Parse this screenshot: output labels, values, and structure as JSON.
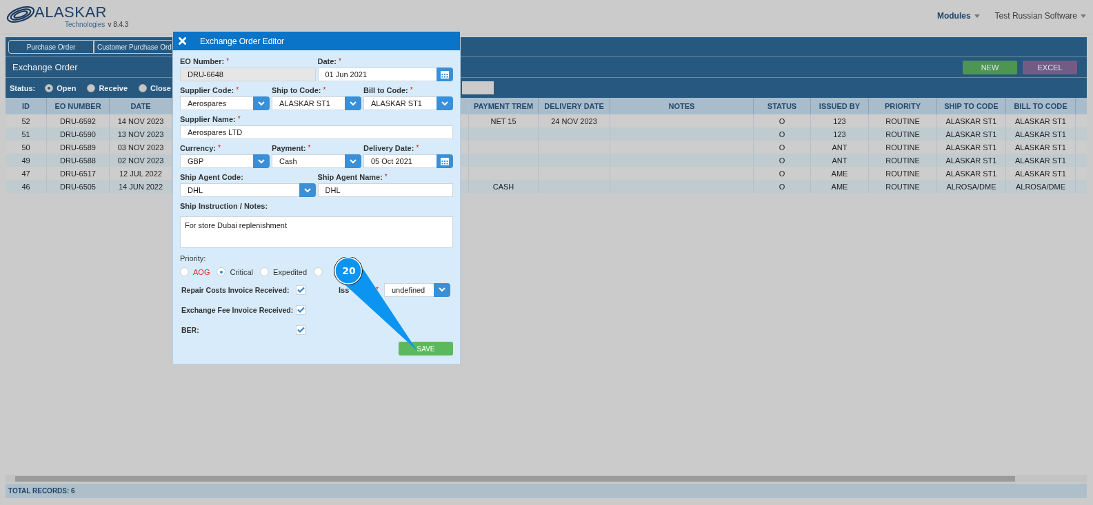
{
  "header": {
    "logo": {
      "name": "ALASKAR",
      "tagline": "Technologies",
      "version": "v 8.4.3"
    },
    "menu": [
      {
        "label": "Modules",
        "bold": true
      },
      {
        "label": "Test Russian Software",
        "bold": false
      }
    ]
  },
  "tabs": [
    {
      "label": "Purchase Order",
      "selected": false
    },
    {
      "label": "Customer Purchase Ord",
      "selected": false
    }
  ],
  "section": {
    "title": "Exchange Order",
    "buttons": [
      {
        "label": "NEW",
        "kind": "new"
      },
      {
        "label": "EXCEL",
        "kind": "excel"
      }
    ]
  },
  "status_filter": {
    "label": "Status:",
    "options": [
      {
        "label": "Open",
        "selected": true
      },
      {
        "label": "Receive",
        "selected": false
      },
      {
        "label": "Close",
        "selected": false
      }
    ]
  },
  "table": {
    "columns": [
      "ID",
      "EO NUMBER",
      "DATE",
      "PAYMENT TREM",
      "DELIVERY DATE",
      "NOTES",
      "STATUS",
      "ISSUED BY",
      "PRIORITY",
      "SHIP TO CODE",
      "BILL TO CODE"
    ],
    "rows": [
      {
        "id": "52",
        "eo_number": "DRU-6592",
        "date": "14 NOV 2023",
        "payment_term": "NET 15",
        "delivery_date": "24 NOV 2023",
        "status": "O",
        "issued_by": "123",
        "priority": "ROUTINE",
        "ship_to": "ALASKAR ST1",
        "bill_to": "ALASKAR ST1"
      },
      {
        "id": "51",
        "eo_number": "DRU-6590",
        "date": "13 NOV 2023",
        "status": "O",
        "issued_by": "123",
        "priority": "ROUTINE",
        "ship_to": "ALASKAR ST1",
        "bill_to": "ALASKAR ST1"
      },
      {
        "id": "50",
        "eo_number": "DRU-6589",
        "date": "03 NOV 2023",
        "status": "O",
        "issued_by": "ANT",
        "priority": "ROUTINE",
        "ship_to": "ALASKAR ST1",
        "bill_to": "ALASKAR ST1"
      },
      {
        "id": "49",
        "eo_number": "DRU-6588",
        "date": "02 NOV 2023",
        "status": "O",
        "issued_by": "ANT",
        "priority": "ROUTINE",
        "ship_to": "ALASKAR ST1",
        "bill_to": "ALASKAR ST1"
      },
      {
        "id": "47",
        "eo_number": "DRU-6517",
        "date": "12 JUL 2022",
        "status": "O",
        "issued_by": "AME",
        "priority": "ROUTINE",
        "ship_to": "ALASKAR ST1",
        "bill_to": "ALASKAR ST1"
      },
      {
        "id": "46",
        "eo_number": "DRU-6505",
        "date": "14 JUN 2022",
        "payment_term": "CASH",
        "status": "O",
        "issued_by": "AME",
        "priority": "ROUTINE",
        "ship_to": "ALROSA/DME",
        "bill_to": "ALROSA/DME"
      }
    ]
  },
  "status_bar": {
    "total": "TOTAL RECORDS: 6"
  },
  "dialog": {
    "title": "Exchange Order Editor",
    "rows": [
      {
        "fields": [
          {
            "label": "EO Number:",
            "mark": "*",
            "kind": "readonly",
            "value": "DRU-6648"
          },
          {
            "label": "Date:",
            "mark": "*",
            "kind": "date",
            "value": "01 Jun 2021"
          }
        ]
      },
      {
        "fields": [
          {
            "label": "Supplier Code:",
            "mark": "*",
            "kind": "select",
            "value": "Aerospares"
          },
          {
            "label": "Ship to Code:",
            "mark": "*",
            "kind": "select",
            "value": "ALASKAR ST1"
          },
          {
            "label": "Bill to Code:",
            "mark": "*",
            "kind": "select",
            "value": "ALASKAR ST1"
          }
        ]
      },
      {
        "fields": [
          {
            "label": "Supplier Name:",
            "mark": "*",
            "kind": "text",
            "value": "Aerospares LTD"
          }
        ]
      },
      {
        "fields": [
          {
            "label": "Currency:",
            "mark": "*",
            "kind": "select",
            "value": "GBP"
          },
          {
            "label": "Payment:",
            "mark": "*",
            "kind": "select",
            "value": "Cash"
          },
          {
            "label": "Delivery Date:",
            "mark": "*",
            "kind": "date",
            "value": "05 Oct 2021"
          }
        ]
      },
      {
        "fields": [
          {
            "label": "Ship Agent Code:",
            "kind": "select",
            "value": "DHL"
          },
          {
            "label": "Ship Agent Name:",
            "mark": "*",
            "kind": "text",
            "value": "DHL"
          }
        ]
      },
      {
        "fields": [
          {
            "label": "Ship Instruction / Notes:",
            "kind": "textarea",
            "value": "For store Dubai replenishment"
          }
        ]
      }
    ],
    "priority": {
      "label": "Priority:",
      "options": [
        {
          "label": "AOG",
          "selected": false,
          "alert": true
        },
        {
          "label": "Critical",
          "selected": true,
          "alert": false
        },
        {
          "label": "Expedited",
          "selected": false,
          "alert": false
        },
        {
          "selected": false
        }
      ]
    },
    "checks": [
      {
        "label": "Repair Costs Invoice Received:",
        "checked": true
      },
      {
        "label": "Exchange Fee Invoice Received:",
        "checked": true
      },
      {
        "label": "BER:",
        "checked": true
      }
    ],
    "issued_by": {
      "label": "Iss",
      "mark": "*",
      "value": "undefined"
    },
    "save": "SAVE"
  },
  "callout": {
    "label": "20"
  }
}
